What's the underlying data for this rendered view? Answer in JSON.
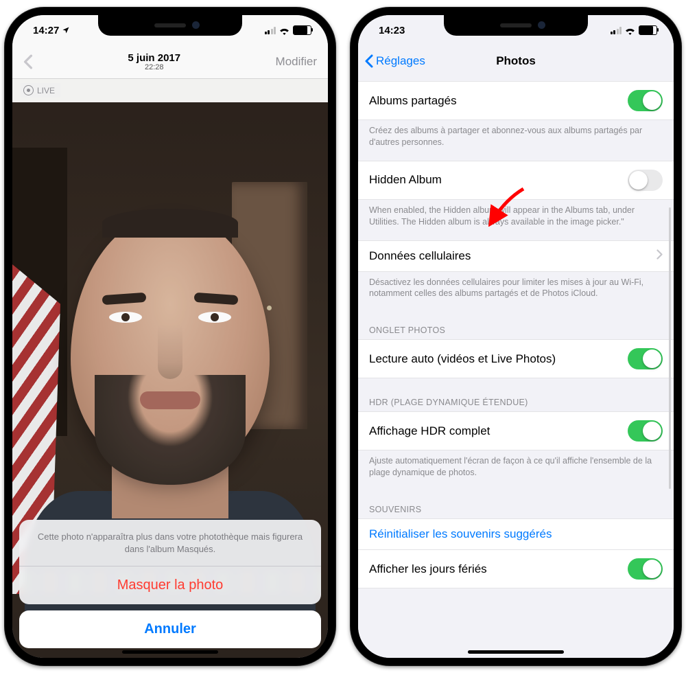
{
  "left": {
    "status": {
      "time": "14:27",
      "location_icon": "location-arrow"
    },
    "nav": {
      "date": "5 juin 2017",
      "time": "22:28",
      "edit": "Modifier"
    },
    "live_badge": "LIVE",
    "sheet": {
      "message": "Cette photo n'apparaîtra plus dans votre photothèque mais figurera dans l'album Masqués.",
      "hide": "Masquer la photo",
      "cancel": "Annuler"
    }
  },
  "right": {
    "status": {
      "time": "14:23"
    },
    "nav": {
      "back": "Réglages",
      "title": "Photos"
    },
    "shared_albums": {
      "label": "Albums partagés",
      "on": true,
      "footer": "Créez des albums à partager et abonnez-vous aux albums partagés par d'autres personnes."
    },
    "hidden_album": {
      "label": "Hidden Album",
      "on": false,
      "footer": "When enabled, the Hidden album will appear in the Albums tab, under Utilities. The Hidden album is always available in the image picker.\""
    },
    "cellular": {
      "label": "Données cellulaires",
      "footer": "Désactivez les données cellulaires pour limiter les mises à jour au Wi-Fi, notamment celles des albums partagés et de Photos iCloud."
    },
    "section_photos_tab": "ONGLET PHOTOS",
    "autoplay": {
      "label": "Lecture auto (vidéos et Live Photos)",
      "on": true
    },
    "section_hdr": "HDR (PLAGE DYNAMIQUE ÉTENDUE)",
    "hdr": {
      "label": "Affichage HDR complet",
      "on": true,
      "footer": "Ajuste automatiquement l'écran de façon à ce qu'il affiche l'ensemble de la plage dynamique de photos."
    },
    "section_memories": "SOUVENIRS",
    "reset_memories": "Réinitialiser les souvenirs suggérés",
    "holidays": {
      "label": "Afficher les jours fériés",
      "on": true
    }
  }
}
